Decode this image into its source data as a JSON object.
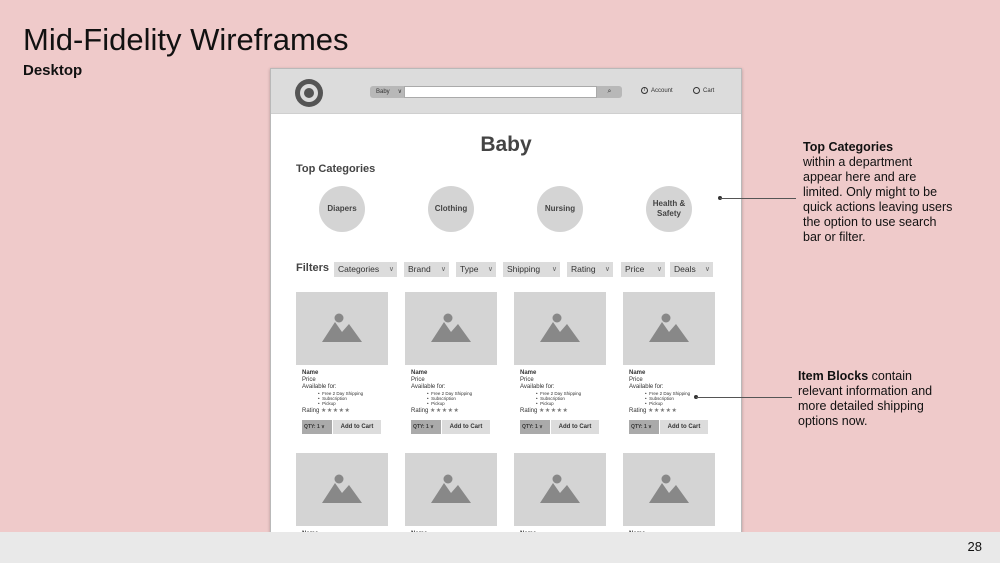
{
  "slide": {
    "title": "Mid-Fidelity Wireframes",
    "subtitle": "Desktop",
    "page_number": "28"
  },
  "header": {
    "search_category": "Baby",
    "account_label": "Account",
    "cart_label": "Cart",
    "icons": {
      "logo": "target-logo",
      "search": "search-icon",
      "account": "account-icon",
      "cart": "cart-icon"
    }
  },
  "department": {
    "title": "Baby",
    "top_categories_label": "Top Categories",
    "categories": [
      "Diapers",
      "Clothing",
      "Nursing",
      "Health & Safety"
    ]
  },
  "filters": {
    "label": "Filters",
    "items": [
      "Categories",
      "Brand",
      "Type",
      "Shipping",
      "Rating",
      "Price",
      "Deals"
    ]
  },
  "product_card": {
    "name": "Name",
    "price": "Price",
    "available_for": "Available for:",
    "shipping_options": [
      "Free 2 Day Shipping",
      "Subscription",
      "Pickup"
    ],
    "rating_label": "Rating",
    "stars": "★★★★★",
    "qty_label": "QTY: 1",
    "add_to_cart": "Add to Cart"
  },
  "annotations": {
    "top_categories": {
      "bold": "Top Categories",
      "text": "within a department appear here and are limited. Only might to be quick actions leaving users the option to use search bar or filter."
    },
    "item_blocks": {
      "bold": "Item Blocks",
      "text": "contain relevant information and more detailed shipping options now."
    }
  }
}
